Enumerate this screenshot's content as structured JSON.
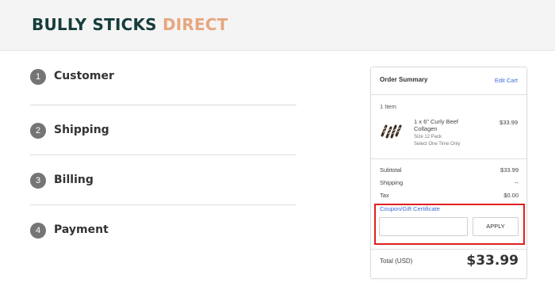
{
  "brand": {
    "name_part1": "BULLY STICKS",
    "name_part2": "DIRECT",
    "colors": {
      "dark": "#163d3b",
      "accent": "#e7a67f"
    }
  },
  "steps": [
    {
      "number": "1",
      "label": "Customer"
    },
    {
      "number": "2",
      "label": "Shipping"
    },
    {
      "number": "3",
      "label": "Billing"
    },
    {
      "number": "4",
      "label": "Payment"
    }
  ],
  "order_summary": {
    "title": "Order Summary",
    "edit_cart_label": "Edit Cart",
    "item_count": "1 Item",
    "items": [
      {
        "name": "1 x 6\" Curly Beef Collagen",
        "price": "$33.99",
        "options": [
          "Size 12 Pack",
          "Select One Time Only"
        ],
        "thumbnail_icon": "curly-beef-collagen-product-icon"
      }
    ],
    "subtotal_label": "Subtotal",
    "subtotal_value": "$33.99",
    "shipping_label": "Shipping",
    "shipping_value": "--",
    "tax_label": "Tax",
    "tax_value": "$0.00",
    "coupon_label": "Coupon/Gift Certificate",
    "coupon_value": "",
    "coupon_placeholder": "",
    "apply_label": "APPLY",
    "total_label": "Total (USD)",
    "total_value": "$33.99",
    "link_color": "#3b6bd6",
    "highlight_color": "#e02020"
  }
}
